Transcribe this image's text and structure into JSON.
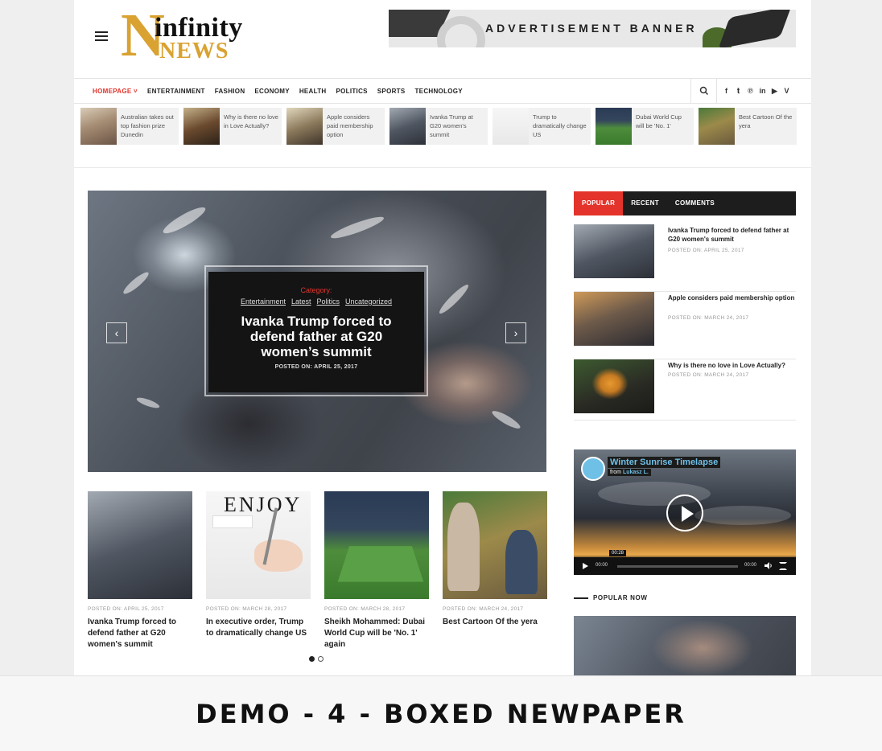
{
  "brand": {
    "logo_letter": "N",
    "logo_top": "infinity",
    "logo_bottom": "NEWS",
    "gold_color": "#d9a231"
  },
  "ad": {
    "text": "ADVERTISEMENT BANNER"
  },
  "nav": {
    "items": [
      {
        "label": "HOMEPAGE ˅",
        "active": true
      },
      {
        "label": "ENTERTAINMENT"
      },
      {
        "label": "FASHION"
      },
      {
        "label": "ECONOMY"
      },
      {
        "label": "HEALTH"
      },
      {
        "label": "POLITICS"
      },
      {
        "label": "SPORTS"
      },
      {
        "label": "TECHNOLOGY"
      }
    ],
    "accent_color": "#e4332b",
    "socials": [
      "f",
      "𝐭",
      "℗",
      "in",
      "▶",
      "V"
    ],
    "social_icons": [
      "facebook-icon",
      "twitter-icon",
      "pinterest-icon",
      "linkedin-icon",
      "youtube-icon",
      "vimeo-icon"
    ]
  },
  "ticker": [
    {
      "title": "Australian takes out top fashion prize Dunedin"
    },
    {
      "title": "Why is there no love in Love Actually?"
    },
    {
      "title": "Apple considers paid membership option"
    },
    {
      "title": "Ivanka Trump at G20 women's summit"
    },
    {
      "title": "Trump to dramatically change US"
    },
    {
      "title": "Dubai World Cup will be 'No. 1'"
    },
    {
      "title": "Best Cartoon Of the yera"
    }
  ],
  "hero": {
    "category_label": "Category:",
    "tags": [
      "Entertainment",
      "Latest",
      "Politics",
      "Uncategorized"
    ],
    "title": "Ivanka Trump forced to defend father at G20 women’s summit",
    "date": "POSTED ON: APRIL 25, 2017",
    "prev": "‹",
    "next": "›"
  },
  "cards": [
    {
      "date": "POSTED ON: APRIL 25, 2017",
      "title": "Ivanka Trump forced to defend father at G20 women's summit"
    },
    {
      "date": "POSTED ON: MARCH 28, 2017",
      "title": "In executive order, Trump to dramatically change US",
      "img_text": "ENJOY"
    },
    {
      "date": "POSTED ON: MARCH 28, 2017",
      "title": "Sheikh Mohammed: Dubai World Cup will be 'No. 1' again"
    },
    {
      "date": "POSTED ON: MARCH 24, 2017",
      "title": "Best Cartoon Of the yera"
    }
  ],
  "sidebar": {
    "tabs": [
      "POPULAR",
      "RECENT",
      "COMMENTS"
    ],
    "items": [
      {
        "title": "Ivanka Trump forced to defend father at G20 women's summit",
        "date": "POSTED ON: APRIL 25, 2017"
      },
      {
        "title": "Apple considers paid membership option",
        "date": "POSTED ON: MARCH 24, 2017"
      },
      {
        "title": "Why is there no love in Love Actually?",
        "date": "POSTED ON: MARCH 24, 2017"
      }
    ],
    "video": {
      "title": "Winter Sunrise Timelapse",
      "from_label": "from",
      "author": "Lukasz L.",
      "time_current": "00:00",
      "time_total": "00:00",
      "tooltip": "00:28"
    },
    "popular_now": "POPULAR NOW"
  },
  "footer": {
    "text": "DEMO - 4 - BOXED NEWPAPER"
  }
}
